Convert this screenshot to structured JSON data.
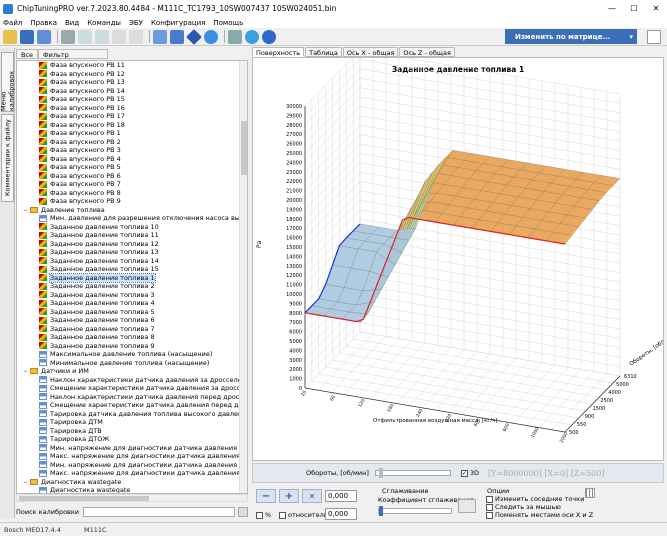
{
  "window": {
    "title": "ChipTuningPRO ver.7.2023.80.4484 - M111C_TC1793_10SW007437 10SW024051.bin"
  },
  "menu": [
    "Файл",
    "Правка",
    "Вид",
    "Команды",
    "ЭБУ",
    "Конфигурация",
    "Помощь"
  ],
  "toolbar": {
    "change_matrix": "Изменить по матрице..."
  },
  "left": {
    "vtabs": [
      "Меню калибровок",
      "Комментарии к файлу"
    ],
    "tabs": [
      "Все",
      "Фильтр"
    ],
    "tree": [
      {
        "label": "Фаза впускного РВ 11",
        "icon": "map3",
        "indent": 2
      },
      {
        "label": "Фаза впускного РВ 12",
        "icon": "map3",
        "indent": 2
      },
      {
        "label": "Фаза впускного РВ 13",
        "icon": "map3",
        "indent": 2
      },
      {
        "label": "Фаза впускного РВ 14",
        "icon": "map3",
        "indent": 2
      },
      {
        "label": "Фаза впускного РВ 15",
        "icon": "map3",
        "indent": 2
      },
      {
        "label": "Фаза впускного РВ 16",
        "icon": "map3",
        "indent": 2
      },
      {
        "label": "Фаза впускного РВ 17",
        "icon": "map3",
        "indent": 2
      },
      {
        "label": "Фаза впускного РВ 18",
        "icon": "map3",
        "indent": 2
      },
      {
        "label": "Фаза впускного РВ 1",
        "icon": "map3",
        "indent": 2
      },
      {
        "label": "Фаза впускного РВ 2",
        "icon": "map3",
        "indent": 2
      },
      {
        "label": "Фаза впускного РВ 3",
        "icon": "map3",
        "indent": 2
      },
      {
        "label": "Фаза впускного РВ 4",
        "icon": "map3",
        "indent": 2
      },
      {
        "label": "Фаза впускного РВ 5",
        "icon": "map3",
        "indent": 2
      },
      {
        "label": "Фаза впускного РВ 6",
        "icon": "map3",
        "indent": 2
      },
      {
        "label": "Фаза впускного РВ 7",
        "icon": "map3",
        "indent": 2
      },
      {
        "label": "Фаза впускного РВ 8",
        "icon": "map3",
        "indent": 2
      },
      {
        "label": "Фаза впускного РВ 9",
        "icon": "map3",
        "indent": 2
      },
      {
        "label": "Давление топлива",
        "icon": "fold",
        "indent": 0,
        "expander": "⌄"
      },
      {
        "label": "Мин. давление для разрешения отключения насоса высокого давл",
        "icon": "map2",
        "indent": 2
      },
      {
        "label": "Заданное давление топлива 10",
        "icon": "map3",
        "indent": 2
      },
      {
        "label": "Заданное давление топлива 11",
        "icon": "map3",
        "indent": 2
      },
      {
        "label": "Заданное давление топлива 12",
        "icon": "map3",
        "indent": 2
      },
      {
        "label": "Заданное давление топлива 13",
        "icon": "map3",
        "indent": 2
      },
      {
        "label": "Заданное давление топлива 14",
        "icon": "map3",
        "indent": 2
      },
      {
        "label": "Заданное давление топлива 15",
        "icon": "map3",
        "indent": 2
      },
      {
        "label": "Заданное давление топлива 1",
        "icon": "map3",
        "indent": 2,
        "selected": true
      },
      {
        "label": "Заданное давление топлива 2",
        "icon": "map3",
        "indent": 2
      },
      {
        "label": "Заданное давление топлива 3",
        "icon": "map3",
        "indent": 2
      },
      {
        "label": "Заданное давление топлива 4",
        "icon": "map3",
        "indent": 2
      },
      {
        "label": "Заданное давление топлива 5",
        "icon": "map3",
        "indent": 2
      },
      {
        "label": "Заданное давление топлива 6",
        "icon": "map3",
        "indent": 2
      },
      {
        "label": "Заданное давление топлива 7",
        "icon": "map3",
        "indent": 2
      },
      {
        "label": "Заданное давление топлива 8",
        "icon": "map3",
        "indent": 2
      },
      {
        "label": "Заданное давление топлива 9",
        "icon": "map3",
        "indent": 2
      },
      {
        "label": "Максимальное давление топлива (насыщение)",
        "icon": "map2",
        "indent": 2
      },
      {
        "label": "Минимальное давление топлива (насыщение)",
        "icon": "map2",
        "indent": 2
      },
      {
        "label": "Датчики и ИМ",
        "icon": "fold",
        "indent": 0,
        "expander": "⌄"
      },
      {
        "label": "Наклон характеристики датчика давления за дросселем",
        "icon": "map2",
        "indent": 2
      },
      {
        "label": "Смещение характеристики датчика давления за дросселем",
        "icon": "map2",
        "indent": 2
      },
      {
        "label": "Наклон характеристики датчика давления перед дросселем",
        "icon": "map2",
        "indent": 2
      },
      {
        "label": "Смещение характеристики датчика давления перед дросселем",
        "icon": "map2",
        "indent": 2
      },
      {
        "label": "Тарировка датчика давления топлива высокого давления",
        "icon": "map2",
        "indent": 2
      },
      {
        "label": "Тарировка ДТМ",
        "icon": "map2",
        "indent": 2
      },
      {
        "label": "Тарировка ДТВ",
        "icon": "map2",
        "indent": 2
      },
      {
        "label": "Тарировка ДТОЖ",
        "icon": "map2",
        "indent": 2
      },
      {
        "label": "Мин. напряжение для диагностики датчика давления за дроссе",
        "icon": "map2",
        "indent": 2
      },
      {
        "label": "Макс. напряжение для диагностики датчика давления за дроссе",
        "icon": "map2",
        "indent": 2
      },
      {
        "label": "Мин. напряжение для диагностики датчика давления перед дро",
        "icon": "map2",
        "indent": 2
      },
      {
        "label": "Макс. напряжение для диагностики датчика давления перед дро",
        "icon": "map2",
        "indent": 2
      },
      {
        "label": "Диагностика wastegate",
        "icon": "fold",
        "indent": 0,
        "expander": "⌄"
      },
      {
        "label": "Диагностика wastegate",
        "icon": "map2",
        "indent": 2
      }
    ],
    "search_label": "Поиск калибровки"
  },
  "right": {
    "tabs": [
      "Поверхность",
      "Таблица",
      "Ось X - общая",
      "Ось Z - общая"
    ],
    "chart_data": {
      "type": "surface3d",
      "title": "Заданное давление топлива 1",
      "zlabel": "Ра",
      "xlabel": "Отфильтрованная воздушная масса, [кг/ч]",
      "ylabel": "Обороты, [об/мин]",
      "z_ticks": [
        "0",
        "1000",
        "2000",
        "3000",
        "4000",
        "5000",
        "6000",
        "7000",
        "8000",
        "9000",
        "10000",
        "11000",
        "12000",
        "13000",
        "14000",
        "15000",
        "16000",
        "17000",
        "18000",
        "19000",
        "20000",
        "21000",
        "22000",
        "23000",
        "24000",
        "25000",
        "26000",
        "27000",
        "28000",
        "29000",
        "30000"
      ],
      "zlim": [
        0,
        30000
      ],
      "y_ticks": [
        "500",
        "550",
        "900",
        "1500",
        "2500",
        "4000",
        "5000",
        "6310"
      ],
      "x_ticks_visible": [
        "20",
        "60",
        "120",
        "180",
        "240",
        "320",
        "400",
        "600",
        "1000",
        "2000"
      ],
      "surface": {
        "low_load_value": 8000,
        "high_load_value": 20000,
        "front_step_x_fraction": 0.3,
        "peak_value": 21000
      }
    },
    "rpm_label": "Обороты, [об/мин]",
    "checkbox_3d": "3D",
    "info": "[Y=8000000] [X=0] [Z=500]",
    "value1": "0,000",
    "value2": "0,000",
    "pct_label": "%",
    "rel_label": "относительно",
    "smooth_title": "Сглаживание",
    "smooth_coef": "Коэффициент сглаживания",
    "options_title": "Опции",
    "options": [
      "Изменить соседние точки",
      "Следить за мышью",
      "Поменять местами оси X и Z"
    ]
  },
  "status": [
    "Bosch MED17.4.4",
    "M111C"
  ]
}
